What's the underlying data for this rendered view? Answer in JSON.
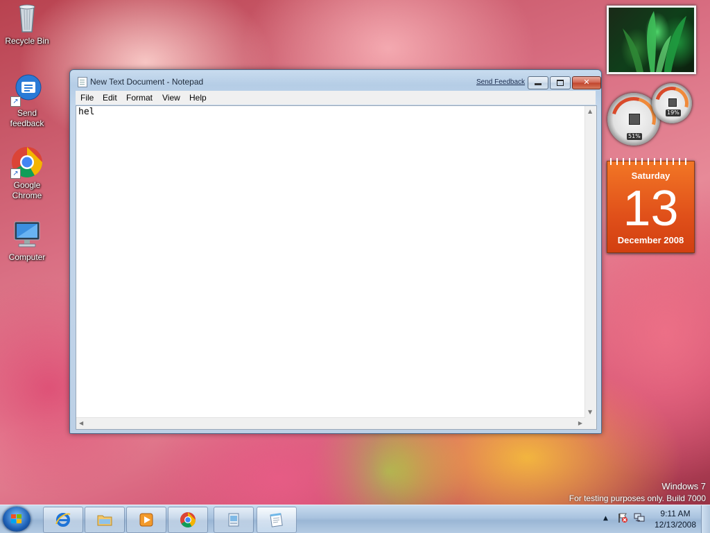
{
  "desktop": {
    "icons": [
      {
        "label": "Recycle Bin",
        "icon": "recycle-bin-icon"
      },
      {
        "label": "Send feedback",
        "icon": "send-feedback-icon",
        "shortcut": true
      },
      {
        "label": "Google Chrome",
        "icon": "chrome-icon",
        "shortcut": true
      },
      {
        "label": "Computer",
        "icon": "computer-icon"
      }
    ],
    "watermark": {
      "line1": "Windows 7",
      "line2": "For testing purposes only. Build 7000"
    }
  },
  "window": {
    "title": "New Text Document - Notepad",
    "feedback_link": "Send Feedback",
    "menu": [
      "File",
      "Edit",
      "Format",
      "View",
      "Help"
    ],
    "content": "hel",
    "controls": {
      "minimize": "minimize-icon",
      "maximize": "maximize-icon",
      "close": "close-icon"
    }
  },
  "gadgets": {
    "cpu_meter": {
      "cpu_percent": 51,
      "memory_percent": 19,
      "cpu_label": "51%",
      "memory_label": "19%"
    },
    "calendar": {
      "day_name": "Saturday",
      "day_number": "13",
      "month_year": "December 2008"
    }
  },
  "taskbar": {
    "items": [
      {
        "name": "internet-explorer",
        "icon": "ie-icon",
        "active": false
      },
      {
        "name": "windows-explorer",
        "icon": "folder-icon",
        "active": false
      },
      {
        "name": "media-player",
        "icon": "media-player-icon",
        "active": false
      },
      {
        "name": "google-chrome",
        "icon": "chrome-icon",
        "active": false
      },
      {
        "name": "document-viewer",
        "icon": "document-icon",
        "active": false
      },
      {
        "name": "notepad",
        "icon": "notepad-icon",
        "active": true
      }
    ],
    "tray": {
      "time": "9:11 AM",
      "date": "12/13/2008"
    }
  },
  "colors": {
    "accent": "#1d5fb5",
    "calendar": "#e0501a",
    "close_button": "#c0432b"
  }
}
